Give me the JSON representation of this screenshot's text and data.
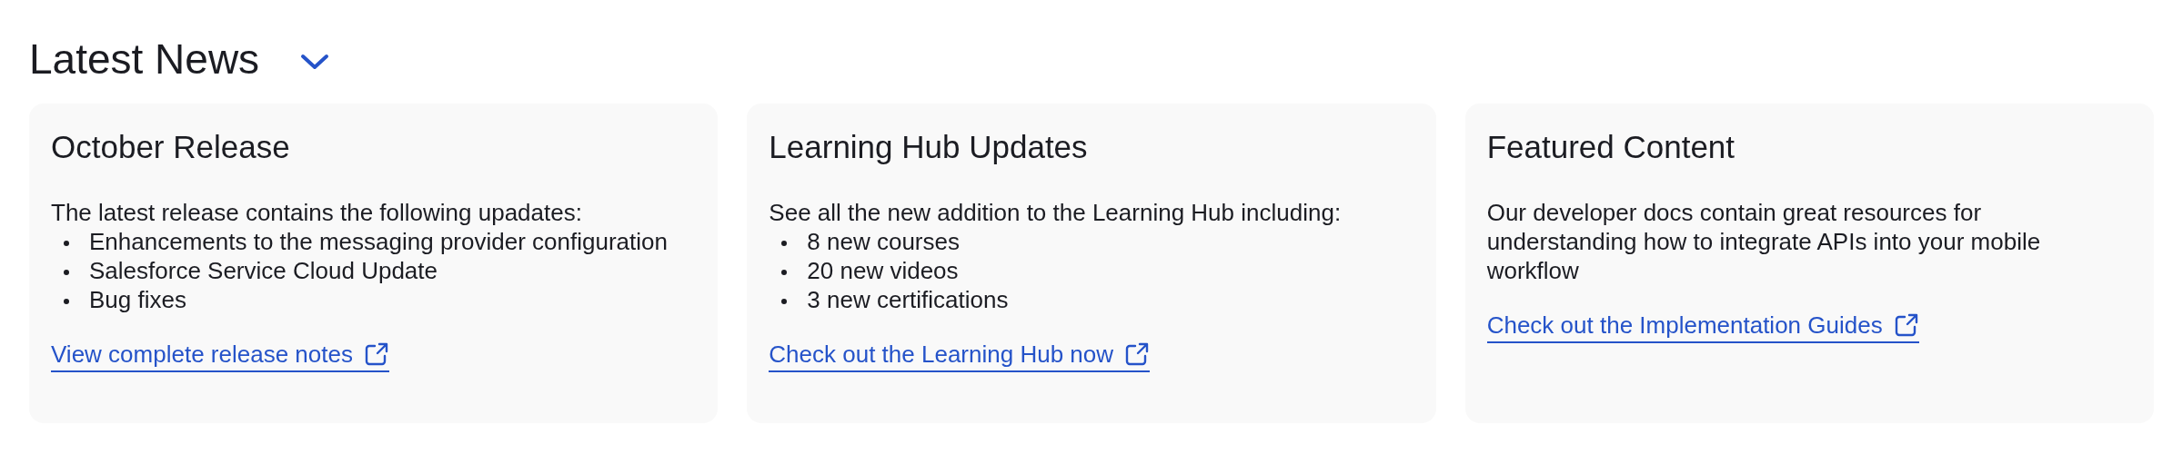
{
  "section": {
    "title": "Latest News",
    "expanded": true
  },
  "cards": [
    {
      "title": "October Release",
      "text": "The latest release contains the following upadates:",
      "items": [
        "Enhancements to the messaging provider configuration",
        "Salesforce Service Cloud Update",
        "Bug fixes"
      ],
      "link": "View complete release notes"
    },
    {
      "title": "Learning Hub Updates",
      "text": "See all the new addition to the Learning Hub including:",
      "items": [
        "8 new courses",
        "20 new videos",
        "3 new certifications"
      ],
      "link": "Check out the Learning Hub now"
    },
    {
      "title": "Featured Content",
      "text": "Our developer docs contain great resources for understanding how to integrate APIs into your mobile workflow",
      "link": "Check out the Implementation Guides"
    }
  ]
}
